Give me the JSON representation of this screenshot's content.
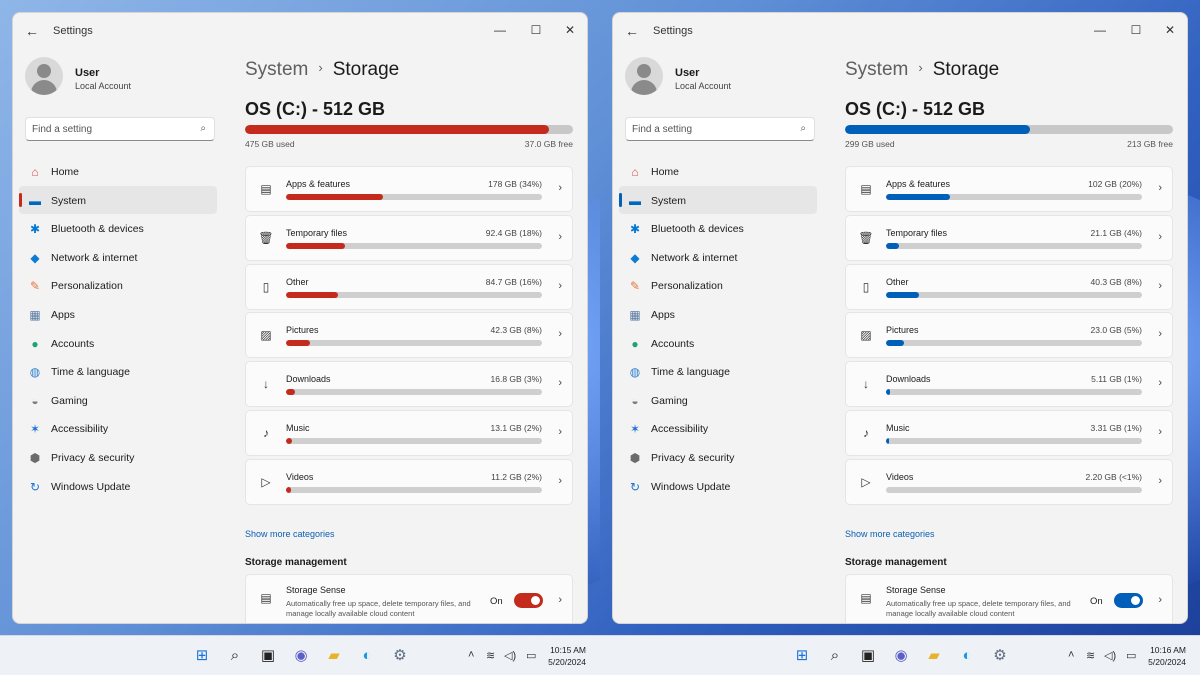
{
  "panes": [
    {
      "accent": "#c42b1c",
      "window_title": "Settings",
      "user": {
        "name": "User",
        "account": "Local Account"
      },
      "search_placeholder": "Find a setting",
      "nav": [
        {
          "label": "Home",
          "icon": "home-icon",
          "color": "#d9534f"
        },
        {
          "label": "System",
          "icon": "system-icon",
          "color": "#0067c0",
          "active": true
        },
        {
          "label": "Bluetooth & devices",
          "icon": "bluetooth-icon",
          "color": "#0078d4"
        },
        {
          "label": "Network & internet",
          "icon": "wifi-icon",
          "color": "#0b7bd6"
        },
        {
          "label": "Personalization",
          "icon": "brush-icon",
          "color": "#e8743b"
        },
        {
          "label": "Apps",
          "icon": "apps-icon",
          "color": "#5a7aa0"
        },
        {
          "label": "Accounts",
          "icon": "accounts-icon",
          "color": "#1aa37a"
        },
        {
          "label": "Time & language",
          "icon": "globe-icon",
          "color": "#2f7fd0"
        },
        {
          "label": "Gaming",
          "icon": "gamepad-icon",
          "color": "#7a7a7a"
        },
        {
          "label": "Accessibility",
          "icon": "accessibility-icon",
          "color": "#1e6fd9"
        },
        {
          "label": "Privacy & security",
          "icon": "shield-icon",
          "color": "#6b6b6b"
        },
        {
          "label": "Windows Update",
          "icon": "update-icon",
          "color": "#1b73d1"
        }
      ],
      "breadcrumb": {
        "parent": "System",
        "sep": "›",
        "current": "Storage"
      },
      "drive": {
        "title": "OS (C:) - 512 GB",
        "used_label": "475 GB used",
        "free_label": "37.0 GB free",
        "used_fraction": 0.928
      },
      "categories": [
        {
          "name": "Apps & features",
          "size": "178 GB (34%)",
          "fraction": 0.38,
          "icon": "apps-features-icon"
        },
        {
          "name": "Temporary files",
          "size": "92.4 GB (18%)",
          "fraction": 0.23,
          "icon": "trash-icon"
        },
        {
          "name": "Other",
          "size": "84.7 GB (16%)",
          "fraction": 0.205,
          "icon": "other-icon"
        },
        {
          "name": "Pictures",
          "size": "42.3 GB (8%)",
          "fraction": 0.095,
          "icon": "picture-icon"
        },
        {
          "name": "Downloads",
          "size": "16.8 GB (3%)",
          "fraction": 0.035,
          "icon": "download-icon"
        },
        {
          "name": "Music",
          "size": "13.1 GB (2%)",
          "fraction": 0.025,
          "icon": "music-icon"
        },
        {
          "name": "Videos",
          "size": "11.2 GB (2%)",
          "fraction": 0.02,
          "icon": "video-icon"
        }
      ],
      "show_more": "Show more categories",
      "management_title": "Storage management",
      "storage_sense": {
        "title": "Storage Sense",
        "desc": "Automatically free up space, delete temporary files, and manage locally available cloud content",
        "state": "On"
      },
      "clock": {
        "time": "10:15 AM",
        "date": "5/20/2024"
      }
    },
    {
      "accent": "#005fb8",
      "window_title": "Settings",
      "user": {
        "name": "User",
        "account": "Local Account"
      },
      "search_placeholder": "Find a setting",
      "nav": [
        {
          "label": "Home",
          "icon": "home-icon",
          "color": "#d9534f"
        },
        {
          "label": "System",
          "icon": "system-icon",
          "color": "#0067c0",
          "active": true
        },
        {
          "label": "Bluetooth & devices",
          "icon": "bluetooth-icon",
          "color": "#0078d4"
        },
        {
          "label": "Network & internet",
          "icon": "wifi-icon",
          "color": "#0b7bd6"
        },
        {
          "label": "Personalization",
          "icon": "brush-icon",
          "color": "#e8743b"
        },
        {
          "label": "Apps",
          "icon": "apps-icon",
          "color": "#5a7aa0"
        },
        {
          "label": "Accounts",
          "icon": "accounts-icon",
          "color": "#1aa37a"
        },
        {
          "label": "Time & language",
          "icon": "globe-icon",
          "color": "#2f7fd0"
        },
        {
          "label": "Gaming",
          "icon": "gamepad-icon",
          "color": "#7a7a7a"
        },
        {
          "label": "Accessibility",
          "icon": "accessibility-icon",
          "color": "#1e6fd9"
        },
        {
          "label": "Privacy & security",
          "icon": "shield-icon",
          "color": "#6b6b6b"
        },
        {
          "label": "Windows Update",
          "icon": "update-icon",
          "color": "#1b73d1"
        }
      ],
      "breadcrumb": {
        "parent": "System",
        "sep": "›",
        "current": "Storage"
      },
      "drive": {
        "title": "OS (C:) - 512 GB",
        "used_label": "299 GB used",
        "free_label": "213 GB free",
        "used_fraction": 0.563
      },
      "categories": [
        {
          "name": "Apps & features",
          "size": "102 GB (20%)",
          "fraction": 0.25,
          "icon": "apps-features-icon"
        },
        {
          "name": "Temporary files",
          "size": "21.1 GB (4%)",
          "fraction": 0.05,
          "icon": "trash-icon"
        },
        {
          "name": "Other",
          "size": "40.3 GB (8%)",
          "fraction": 0.13,
          "icon": "other-icon"
        },
        {
          "name": "Pictures",
          "size": "23.0 GB (5%)",
          "fraction": 0.07,
          "icon": "picture-icon"
        },
        {
          "name": "Downloads",
          "size": "5.11 GB (1%)",
          "fraction": 0.015,
          "icon": "download-icon"
        },
        {
          "name": "Music",
          "size": "3.31 GB (1%)",
          "fraction": 0.012,
          "icon": "music-icon"
        },
        {
          "name": "Videos",
          "size": "2.20 GB (<1%)",
          "fraction": 0.0,
          "icon": "video-icon"
        }
      ],
      "show_more": "Show more categories",
      "management_title": "Storage management",
      "storage_sense": {
        "title": "Storage Sense",
        "desc": "Automatically free up space, delete temporary files, and manage locally available cloud content",
        "state": "On"
      },
      "clock": {
        "time": "10:16 AM",
        "date": "5/20/2024"
      }
    }
  ]
}
